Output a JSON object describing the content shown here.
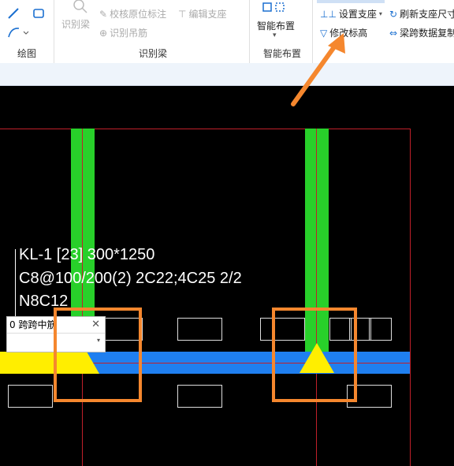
{
  "ribbon": {
    "draw_group_label": "绘图",
    "recognize_group_label": "识别梁",
    "smart_group_label": "智能布置",
    "recognize_beam": "识别梁",
    "check_position": "校核原位标注",
    "edit_support": "编辑支座",
    "recognize_stirrup": "识别吊筋",
    "smart_layout": "智能布置",
    "set_support": "设置支座",
    "refresh_support": "刷新支座尺寸",
    "modify_elevation": "修改标高",
    "span_data": "梁跨数据复制"
  },
  "annotation": {
    "line1": "KL-1 [23] 300*1250",
    "line2": "C8@100/200(2) 2C22;4C25 2/2",
    "line3": "N8C12"
  },
  "popup": {
    "title": "0 跨跨中筋",
    "close": "✕",
    "select_value": ""
  },
  "colors": {
    "column": "#28d02a",
    "beam": "#1f7ff0",
    "support": "#ffee00",
    "highlight": "#f5872e"
  }
}
